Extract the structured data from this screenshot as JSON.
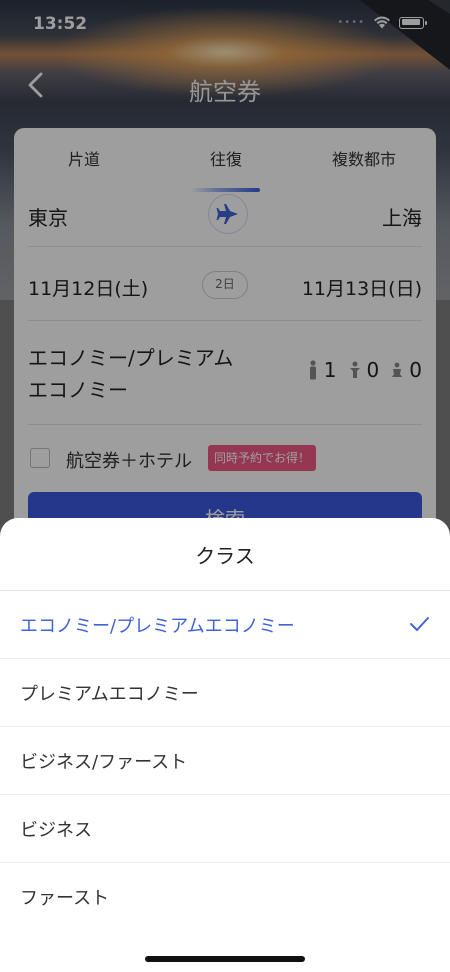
{
  "status_bar": {
    "time": "13:52"
  },
  "nav": {
    "title": "航空券"
  },
  "tabs": [
    "片道",
    "往復",
    "複数都市"
  ],
  "route": {
    "from": "東京",
    "to": "上海"
  },
  "dates": {
    "departure": "11月12日(土)",
    "days": "2日",
    "return": "11月13日(日)"
  },
  "cabin": {
    "line1": "エコノミー/プレミアム",
    "line2": "エコノミー"
  },
  "passengers": {
    "adults": "1",
    "children": "0",
    "infants": "0"
  },
  "hotel": {
    "label": "航空券＋ホテル",
    "promo": "同時予約でお得！"
  },
  "search": {
    "label": "検索"
  },
  "sheet": {
    "title": "クラス",
    "options": [
      "エコノミー/プレミアムエコノミー",
      "プレミアムエコノミー",
      "ビジネス/ファースト",
      "ビジネス",
      "ファースト"
    ],
    "selected_index": 0
  },
  "colors": {
    "accent": "#3f63d8",
    "promo": "#f05a87",
    "button": "#3a5ae0"
  }
}
